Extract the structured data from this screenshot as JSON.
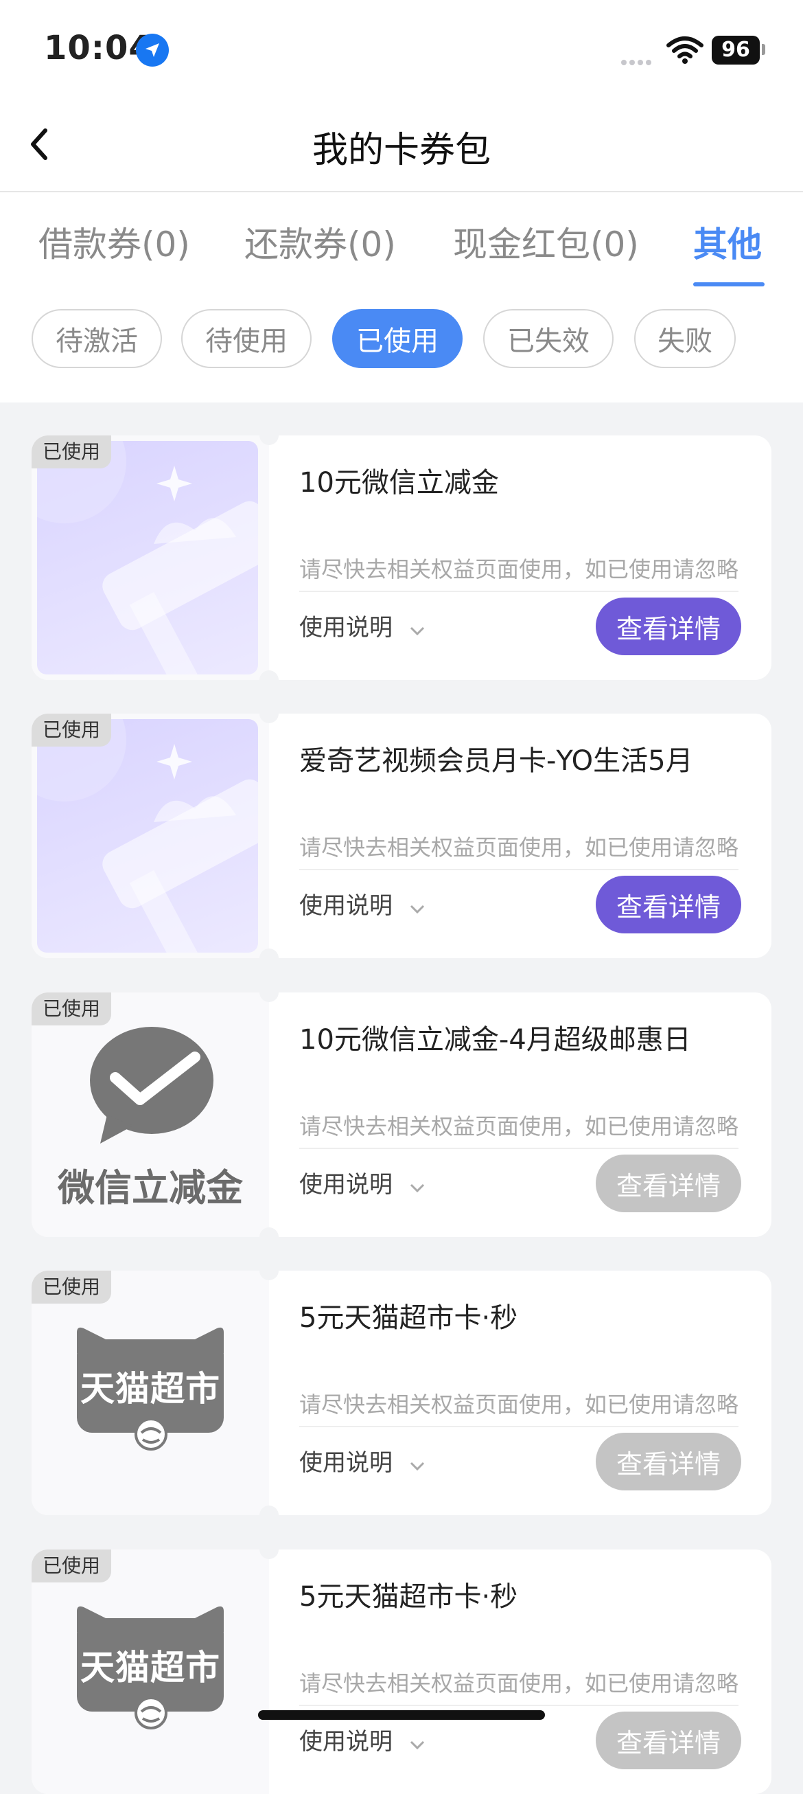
{
  "status_bar": {
    "time": "10:04",
    "battery": "96"
  },
  "nav": {
    "title": "我的卡券包"
  },
  "tabs": [
    {
      "label": "借款券(0)"
    },
    {
      "label": "还款券(0)"
    },
    {
      "label": "现金红包(0)"
    },
    {
      "label": "其他",
      "active": true
    }
  ],
  "filters": [
    {
      "label": "待激活"
    },
    {
      "label": "待使用"
    },
    {
      "label": "已使用",
      "active": true
    },
    {
      "label": "已失效"
    },
    {
      "label": "失败"
    }
  ],
  "cards": [
    {
      "badge": "已使用",
      "title": "10元微信立减金",
      "desc": "请尽快去相关权益页面使用，如已使用请忽略",
      "usage": "使用说明",
      "button": "查看详情",
      "art": "gift"
    },
    {
      "badge": "已使用",
      "title": "爱奇艺视频会员月卡-YO生活5月",
      "desc": "请尽快去相关权益页面使用，如已使用请忽略",
      "usage": "使用说明",
      "button": "查看详情",
      "art": "gift"
    },
    {
      "badge": "已使用",
      "title": "10元微信立减金-4月超级邮惠日",
      "desc": "请尽快去相关权益页面使用，如已使用请忽略",
      "usage": "使用说明",
      "button": "查看详情",
      "art": "wechat",
      "art_label": "微信立减金"
    },
    {
      "badge": "已使用",
      "title": "5元天猫超市卡·秒",
      "desc": "请尽快去相关权益页面使用，如已使用请忽略",
      "usage": "使用说明",
      "button": "查看详情",
      "art": "tmall",
      "art_label": "天猫超市"
    },
    {
      "badge": "已使用",
      "title": "5元天猫超市卡·秒",
      "desc": "请尽快去相关权益页面使用，如已使用请忽略",
      "usage": "使用说明",
      "button": "查看详情",
      "art": "tmall",
      "art_label": "天猫超市"
    }
  ]
}
